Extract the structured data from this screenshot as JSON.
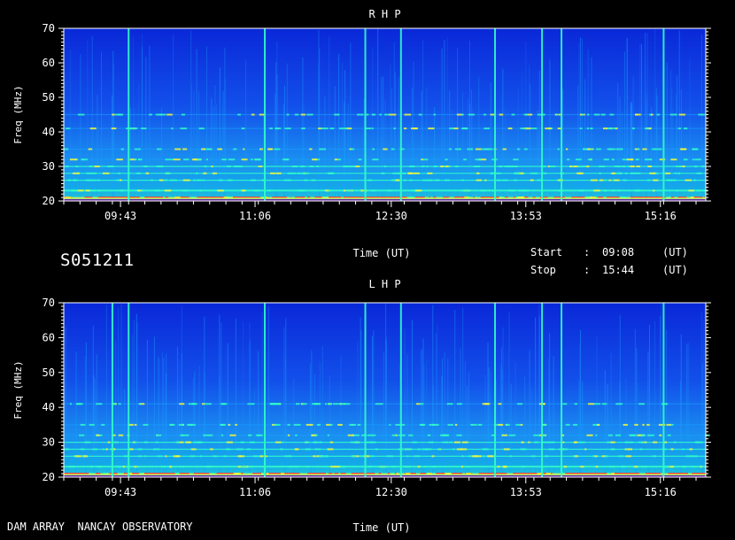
{
  "station_id": "S051211",
  "footer_left": "DAM ARRAY  NANCAY OBSERVATORY",
  "time_info": {
    "start_label": "Start",
    "start_value": "09:08",
    "stop_label": "Stop",
    "stop_value": "15:44",
    "colon": ":",
    "unit": "(UT)"
  },
  "colors": {
    "background": "#000000",
    "low": "#0a2bd8",
    "mid": "#19a0ff",
    "high": "#30ffc8",
    "peak": "#ffff30",
    "burst": "#ff3030"
  },
  "chart_data": [
    {
      "type": "heatmap",
      "title": "R H P",
      "xlabel": "Time (UT)",
      "ylabel": "Freq (MHz)",
      "ylim": [
        20,
        70
      ],
      "xlim": [
        "09:08",
        "15:44"
      ],
      "yticks": [
        20,
        30,
        40,
        50,
        60,
        70
      ],
      "xticks": [
        "09:43",
        "11:06",
        "12:30",
        "13:53",
        "15:16"
      ],
      "vertical_bursts": [
        "09:48",
        "11:12",
        "12:14",
        "12:36",
        "13:34",
        "14:03",
        "14:15",
        "15:18"
      ],
      "emission_bands_mhz": [
        21,
        23,
        26,
        28,
        30,
        32,
        35,
        41,
        45
      ]
    },
    {
      "type": "heatmap",
      "title": "L H P",
      "xlabel": "Time (UT)",
      "ylabel": "Freq (MHz)",
      "ylim": [
        20,
        70
      ],
      "xlim": [
        "09:08",
        "15:44"
      ],
      "yticks": [
        20,
        30,
        40,
        50,
        60,
        70
      ],
      "xticks": [
        "09:43",
        "11:06",
        "12:30",
        "13:53",
        "15:16"
      ],
      "vertical_bursts": [
        "09:38",
        "09:48",
        "11:12",
        "12:14",
        "12:36",
        "13:34",
        "14:03",
        "14:15",
        "15:18"
      ],
      "emission_bands_mhz": [
        21,
        23,
        26,
        28,
        30,
        32,
        35,
        41
      ]
    }
  ]
}
